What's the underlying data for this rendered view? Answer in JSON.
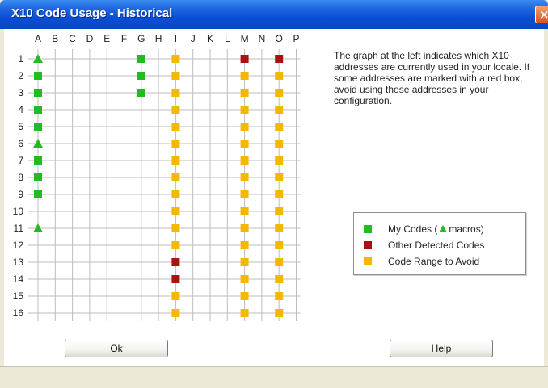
{
  "window": {
    "title": "X10 Code Usage - Historical",
    "close_icon": "close-icon"
  },
  "grid": {
    "columns": [
      "A",
      "B",
      "C",
      "D",
      "E",
      "F",
      "G",
      "H",
      "I",
      "J",
      "K",
      "L",
      "M",
      "N",
      "O",
      "P"
    ],
    "rows": [
      "1",
      "2",
      "3",
      "4",
      "5",
      "6",
      "7",
      "8",
      "9",
      "10",
      "11",
      "12",
      "13",
      "14",
      "15",
      "16"
    ],
    "marks": [
      {
        "col": "A",
        "row": 1,
        "kind": "macro"
      },
      {
        "col": "A",
        "row": 2,
        "kind": "mine"
      },
      {
        "col": "A",
        "row": 3,
        "kind": "mine"
      },
      {
        "col": "A",
        "row": 4,
        "kind": "mine"
      },
      {
        "col": "A",
        "row": 5,
        "kind": "mine"
      },
      {
        "col": "A",
        "row": 6,
        "kind": "macro"
      },
      {
        "col": "A",
        "row": 7,
        "kind": "mine"
      },
      {
        "col": "A",
        "row": 8,
        "kind": "mine"
      },
      {
        "col": "A",
        "row": 9,
        "kind": "mine"
      },
      {
        "col": "A",
        "row": 11,
        "kind": "macro"
      },
      {
        "col": "G",
        "row": 1,
        "kind": "mine"
      },
      {
        "col": "G",
        "row": 2,
        "kind": "mine"
      },
      {
        "col": "G",
        "row": 3,
        "kind": "mine"
      },
      {
        "col": "I",
        "row": 1,
        "kind": "avoid"
      },
      {
        "col": "I",
        "row": 2,
        "kind": "avoid"
      },
      {
        "col": "I",
        "row": 3,
        "kind": "avoid"
      },
      {
        "col": "I",
        "row": 4,
        "kind": "avoid"
      },
      {
        "col": "I",
        "row": 5,
        "kind": "avoid"
      },
      {
        "col": "I",
        "row": 6,
        "kind": "avoid"
      },
      {
        "col": "I",
        "row": 7,
        "kind": "avoid"
      },
      {
        "col": "I",
        "row": 8,
        "kind": "avoid"
      },
      {
        "col": "I",
        "row": 9,
        "kind": "avoid"
      },
      {
        "col": "I",
        "row": 10,
        "kind": "avoid"
      },
      {
        "col": "I",
        "row": 11,
        "kind": "avoid"
      },
      {
        "col": "I",
        "row": 12,
        "kind": "avoid"
      },
      {
        "col": "I",
        "row": 13,
        "kind": "other"
      },
      {
        "col": "I",
        "row": 14,
        "kind": "other"
      },
      {
        "col": "I",
        "row": 15,
        "kind": "avoid"
      },
      {
        "col": "I",
        "row": 16,
        "kind": "avoid"
      },
      {
        "col": "M",
        "row": 1,
        "kind": "other"
      },
      {
        "col": "M",
        "row": 2,
        "kind": "avoid"
      },
      {
        "col": "M",
        "row": 3,
        "kind": "avoid"
      },
      {
        "col": "M",
        "row": 4,
        "kind": "avoid"
      },
      {
        "col": "M",
        "row": 5,
        "kind": "avoid"
      },
      {
        "col": "M",
        "row": 6,
        "kind": "avoid"
      },
      {
        "col": "M",
        "row": 7,
        "kind": "avoid"
      },
      {
        "col": "M",
        "row": 8,
        "kind": "avoid"
      },
      {
        "col": "M",
        "row": 9,
        "kind": "avoid"
      },
      {
        "col": "M",
        "row": 10,
        "kind": "avoid"
      },
      {
        "col": "M",
        "row": 11,
        "kind": "avoid"
      },
      {
        "col": "M",
        "row": 12,
        "kind": "avoid"
      },
      {
        "col": "M",
        "row": 13,
        "kind": "avoid"
      },
      {
        "col": "M",
        "row": 14,
        "kind": "avoid"
      },
      {
        "col": "M",
        "row": 15,
        "kind": "avoid"
      },
      {
        "col": "M",
        "row": 16,
        "kind": "avoid"
      },
      {
        "col": "O",
        "row": 1,
        "kind": "other"
      },
      {
        "col": "O",
        "row": 2,
        "kind": "avoid"
      },
      {
        "col": "O",
        "row": 3,
        "kind": "avoid"
      },
      {
        "col": "O",
        "row": 4,
        "kind": "avoid"
      },
      {
        "col": "O",
        "row": 5,
        "kind": "avoid"
      },
      {
        "col": "O",
        "row": 6,
        "kind": "avoid"
      },
      {
        "col": "O",
        "row": 7,
        "kind": "avoid"
      },
      {
        "col": "O",
        "row": 8,
        "kind": "avoid"
      },
      {
        "col": "O",
        "row": 9,
        "kind": "avoid"
      },
      {
        "col": "O",
        "row": 10,
        "kind": "avoid"
      },
      {
        "col": "O",
        "row": 11,
        "kind": "avoid"
      },
      {
        "col": "O",
        "row": 12,
        "kind": "avoid"
      },
      {
        "col": "O",
        "row": 13,
        "kind": "avoid"
      },
      {
        "col": "O",
        "row": 14,
        "kind": "avoid"
      },
      {
        "col": "O",
        "row": 15,
        "kind": "avoid"
      },
      {
        "col": "O",
        "row": 16,
        "kind": "avoid"
      }
    ]
  },
  "description": "The graph at the left indicates which X10 addresses are currently used in your locale. If some addresses are marked with a red box, avoid using those addresses in your configuration.",
  "legend": {
    "my_codes_pre": "My Codes (",
    "my_codes_post": "macros)",
    "other_detected": "Other Detected Codes",
    "avoid": "Code Range to Avoid"
  },
  "colors": {
    "mine": "#22bb22",
    "other": "#aa1111",
    "avoid": "#f5b800",
    "grid": "#bdbdbd",
    "title_bar": "#0b4fd6"
  },
  "buttons": {
    "ok": "Ok",
    "help": "Help"
  }
}
